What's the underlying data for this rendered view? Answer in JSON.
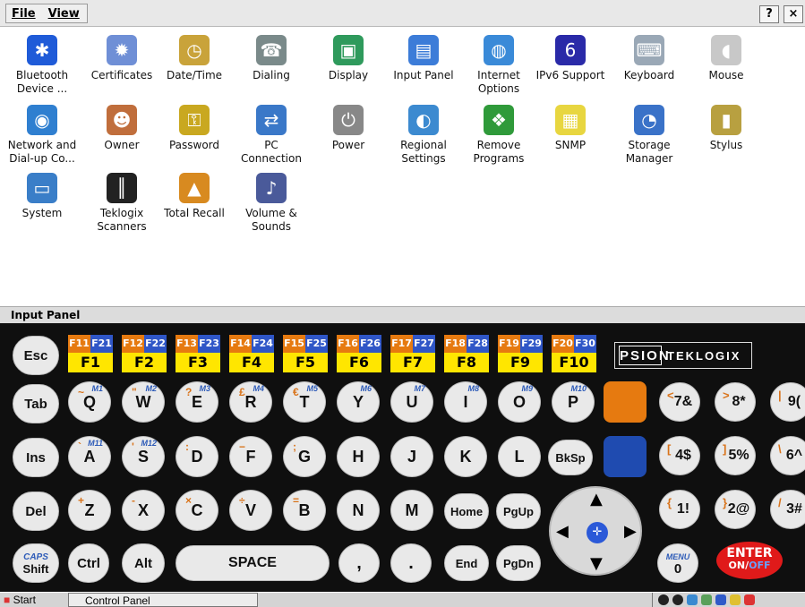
{
  "menu": {
    "file": "File",
    "view": "View",
    "help": "?",
    "close": "×"
  },
  "icons": [
    {
      "id": "bluetooth",
      "label": "Bluetooth Device ...",
      "color": "#1f5bd8",
      "glyph": "✱"
    },
    {
      "id": "certificates",
      "label": "Certificates",
      "color": "#6f8fd6",
      "glyph": "✹"
    },
    {
      "id": "datetime",
      "label": "Date/Time",
      "color": "#c9a33a",
      "glyph": "◷"
    },
    {
      "id": "dialing",
      "label": "Dialing",
      "color": "#7a8a8a",
      "glyph": "☎"
    },
    {
      "id": "display",
      "label": "Display",
      "color": "#2f9a5c",
      "glyph": "▣"
    },
    {
      "id": "inputpanel",
      "label": "Input Panel",
      "color": "#3c7cd8",
      "glyph": "▤"
    },
    {
      "id": "internet",
      "label": "Internet Options",
      "color": "#3a8ad8",
      "glyph": "◍"
    },
    {
      "id": "ipv6",
      "label": "IPv6 Support",
      "color": "#2a2aa8",
      "glyph": "6"
    },
    {
      "id": "keyboard",
      "label": "Keyboard",
      "color": "#9aa8b6",
      "glyph": "⌨"
    },
    {
      "id": "mouse",
      "label": "Mouse",
      "color": "#c8c8c8",
      "glyph": "◖"
    },
    {
      "id": "network",
      "label": "Network and Dial-up Co...",
      "color": "#2f7fd0",
      "glyph": "◉"
    },
    {
      "id": "owner",
      "label": "Owner",
      "color": "#c06e3c",
      "glyph": "☻"
    },
    {
      "id": "password",
      "label": "Password",
      "color": "#c9a820",
      "glyph": "⚿"
    },
    {
      "id": "pcconnection",
      "label": "PC Connection",
      "color": "#3a78c8",
      "glyph": "⇄"
    },
    {
      "id": "power",
      "label": "Power",
      "color": "#888",
      "glyph": "⏻"
    },
    {
      "id": "regional",
      "label": "Regional Settings",
      "color": "#3c8ad0",
      "glyph": "◐"
    },
    {
      "id": "removeprograms",
      "label": "Remove Programs",
      "color": "#2f9a3a",
      "glyph": "❖"
    },
    {
      "id": "snmp",
      "label": "SNMP",
      "color": "#e8d640",
      "glyph": "▦"
    },
    {
      "id": "storage",
      "label": "Storage Manager",
      "color": "#3a72c8",
      "glyph": "◔"
    },
    {
      "id": "stylus",
      "label": "Stylus",
      "color": "#b8a040",
      "glyph": "▮"
    },
    {
      "id": "system",
      "label": "System",
      "color": "#3a7ec8",
      "glyph": "▭"
    },
    {
      "id": "teklogix",
      "label": "Teklogix Scanners",
      "color": "#222",
      "glyph": "║"
    },
    {
      "id": "totalrecall",
      "label": "Total Recall",
      "color": "#d88a20",
      "glyph": "▲"
    },
    {
      "id": "volume",
      "label": "Volume & Sounds",
      "color": "#4a5a9a",
      "glyph": "♪"
    }
  ],
  "input_panel_title": "Input Panel",
  "keyboard": {
    "esc": "Esc",
    "tab": "Tab",
    "ins": "Ins",
    "del": "Del",
    "caps": "CAPS",
    "shift": "Shift",
    "ctrl": "Ctrl",
    "alt": "Alt",
    "space": "SPACE",
    "comma": ",",
    "period": ".",
    "end": "End",
    "pgdn": "PgDn",
    "home": "Home",
    "pgup": "PgUp",
    "bksp": "BkSp",
    "menu": "MENU",
    "zero": "0",
    "enter": "ENTER",
    "on": "ON/",
    "off": "OFF",
    "brand_psion": "PSION",
    "brand_teklogix": "TEKLOGIX",
    "fkeys": [
      {
        "o": "F11",
        "b": "F21",
        "m": "F1"
      },
      {
        "o": "F12",
        "b": "F22",
        "m": "F2"
      },
      {
        "o": "F13",
        "b": "F23",
        "m": "F3"
      },
      {
        "o": "F14",
        "b": "F24",
        "m": "F4"
      },
      {
        "o": "F15",
        "b": "F25",
        "m": "F5"
      },
      {
        "o": "F16",
        "b": "F26",
        "m": "F6"
      },
      {
        "o": "F17",
        "b": "F27",
        "m": "F7"
      },
      {
        "o": "F18",
        "b": "F28",
        "m": "F8"
      },
      {
        "o": "F19",
        "b": "F29",
        "m": "F9"
      },
      {
        "o": "F20",
        "b": "F30",
        "m": "F10"
      }
    ],
    "row1": [
      {
        "k": "Q",
        "s": "~",
        "m": "M1"
      },
      {
        "k": "W",
        "s": "\"",
        "m": "M2"
      },
      {
        "k": "E",
        "s": "?",
        "m": "M3"
      },
      {
        "k": "R",
        "s": "£",
        "m": "M4"
      },
      {
        "k": "T",
        "s": "€",
        "m": "M5"
      },
      {
        "k": "Y",
        "s": "",
        "m": "M6"
      },
      {
        "k": "U",
        "s": "",
        "m": "M7"
      },
      {
        "k": "I",
        "s": "",
        "m": "M8"
      },
      {
        "k": "O",
        "s": "",
        "m": "M9"
      },
      {
        "k": "P",
        "s": "",
        "m": "M10"
      }
    ],
    "row2": [
      {
        "k": "A",
        "s": "`",
        "m": "M11"
      },
      {
        "k": "S",
        "s": "'",
        "m": "M12"
      },
      {
        "k": "D",
        "s": ":"
      },
      {
        "k": "F",
        "s": "−"
      },
      {
        "k": "G",
        "s": ";"
      },
      {
        "k": "H",
        "s": ""
      },
      {
        "k": "J",
        "s": ""
      },
      {
        "k": "K",
        "s": ""
      },
      {
        "k": "L",
        "s": ""
      }
    ],
    "row3": [
      {
        "k": "Z",
        "s": "+"
      },
      {
        "k": "X",
        "s": "-"
      },
      {
        "k": "C",
        "s": "×"
      },
      {
        "k": "V",
        "s": "÷"
      },
      {
        "k": "B",
        "s": "="
      },
      {
        "k": "N",
        "s": ""
      },
      {
        "k": "M",
        "s": ""
      }
    ],
    "num": [
      [
        "<",
        "7&"
      ],
      [
        ">",
        "8*"
      ],
      [
        "|",
        "9("
      ],
      [
        "[",
        "4$"
      ],
      [
        "]",
        "5%"
      ],
      [
        "\\",
        "6^"
      ],
      [
        "{",
        "1!"
      ],
      [
        "}",
        "2@"
      ],
      [
        "/",
        "3#"
      ]
    ]
  },
  "taskbar": {
    "start": "Start",
    "active_window": "Control Panel"
  },
  "colors": {
    "orange": "#e67a10",
    "blue": "#2f56c7",
    "yellow": "#ffe600",
    "enter": "#e01a1a"
  }
}
